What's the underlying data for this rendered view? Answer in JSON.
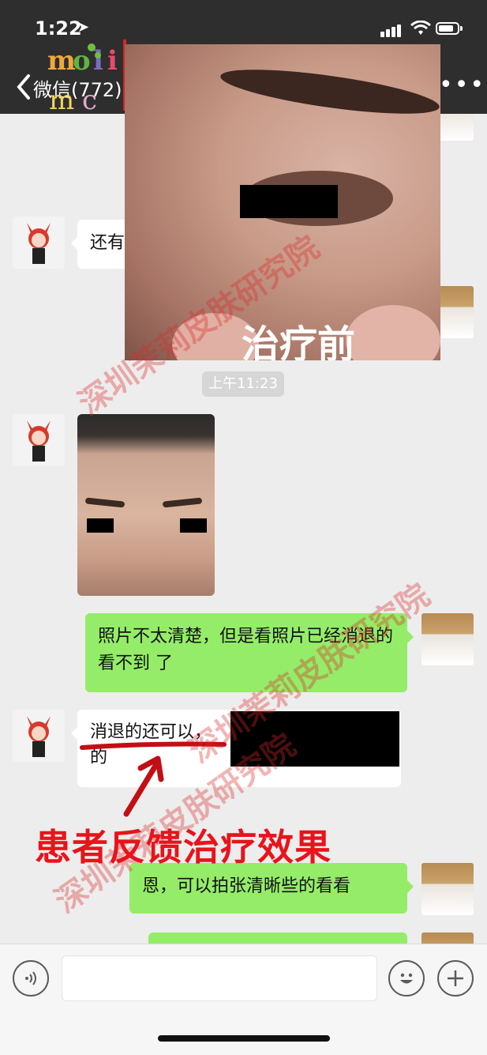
{
  "status": {
    "time": "1:22",
    "location_icon": "location-arrow-icon"
  },
  "nav": {
    "back_label": "微信(772)",
    "more_label": "•••"
  },
  "overlay": {
    "caption": "治疗前"
  },
  "chat": {
    "msg1_text": "还有",
    "timestamp": "上午11:23",
    "msg3_text": "照片不太清楚，但是看照片已经消退的看不到 了",
    "msg4_line1": "消退的还可以，",
    "msg4_line2": "的",
    "msg5_text": "恩，可以拍张清晰些的看看"
  },
  "annotation": {
    "feedback_label": "患者反馈治疗效果"
  },
  "watermark": {
    "text": "深圳茉莉皮肤研究院"
  },
  "colors": {
    "bubble_out": "#95ec69",
    "bubble_in": "#ffffff",
    "accent_red": "#e8131b",
    "bar": "#2e2e2e"
  }
}
